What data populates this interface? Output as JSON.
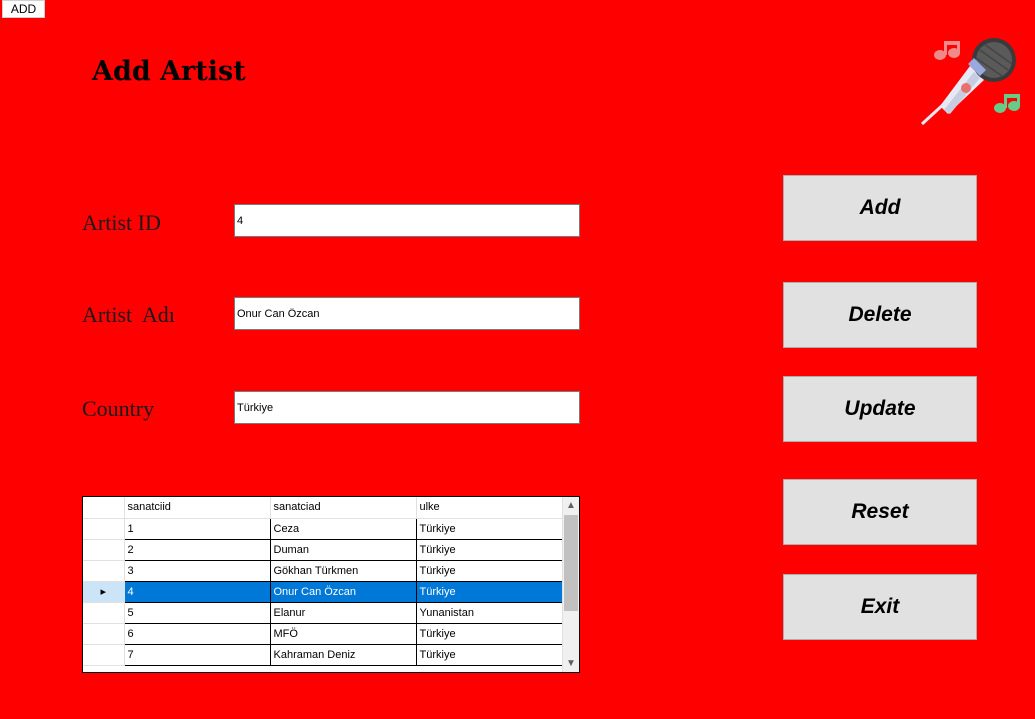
{
  "window": {
    "tab_label": "ADD"
  },
  "header": {
    "title": "Add Artist"
  },
  "form": {
    "artist_id": {
      "label": "Artist ID",
      "value": "4"
    },
    "artist_name": {
      "label": "Artist  Adı",
      "value": "Onur Can Özcan"
    },
    "country": {
      "label": "Country",
      "value": "Türkiye"
    }
  },
  "actions": {
    "add": "Add",
    "delete": "Delete",
    "update": "Update",
    "reset": "Reset",
    "exit": "Exit"
  },
  "grid": {
    "columns": [
      "sanatciid",
      "sanatciad",
      "ulke"
    ],
    "rows": [
      [
        "1",
        "Ceza",
        "Türkiye"
      ],
      [
        "2",
        "Duman",
        "Türkiye"
      ],
      [
        "3",
        "Gökhan Türkmen",
        "Türkiye"
      ],
      [
        "4",
        "Onur Can Özcan",
        "Türkiye"
      ],
      [
        "5",
        "Elanur",
        "Yunanistan"
      ],
      [
        "6",
        "MFÖ",
        "Türkiye"
      ],
      [
        "7",
        "Kahraman Deniz",
        "Türkiye"
      ]
    ],
    "selected_row": 3
  },
  "colors": {
    "background": "#ff0000",
    "selection": "#0078d7",
    "button_face": "#e1e1e1"
  },
  "icons": {
    "logo": "microphone-icon"
  }
}
